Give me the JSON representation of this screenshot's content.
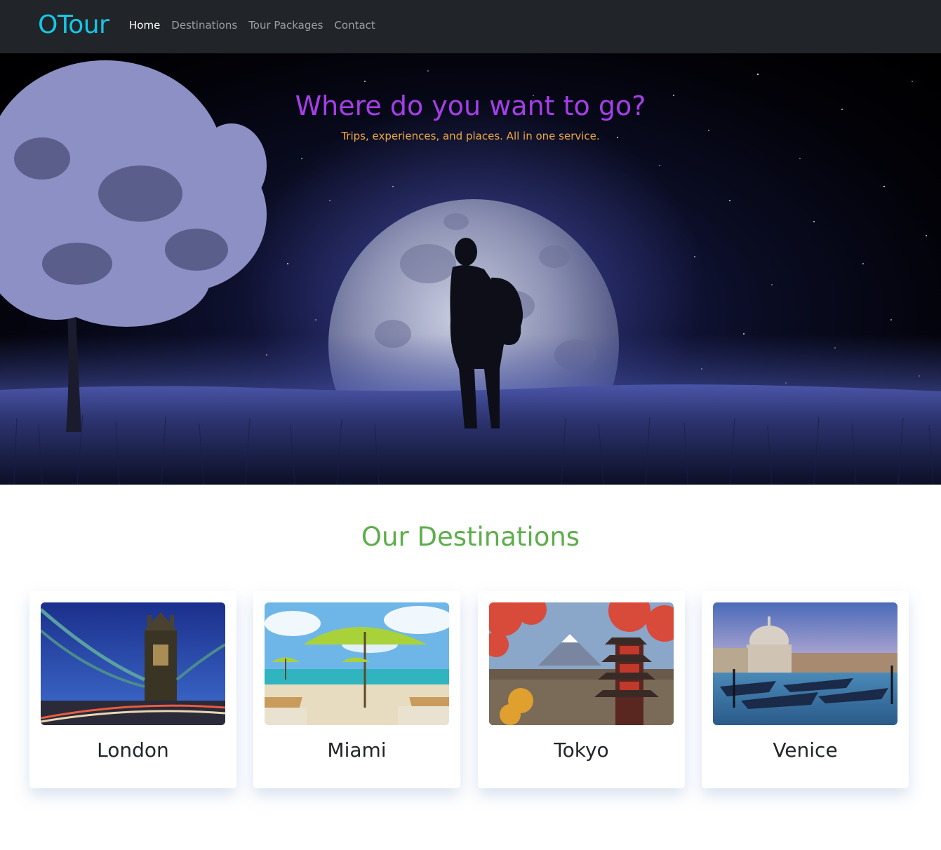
{
  "navbar": {
    "brand": "OTour",
    "links": [
      {
        "label": "Home",
        "active": true
      },
      {
        "label": "Destinations",
        "active": false
      },
      {
        "label": "Tour Packages",
        "active": false
      },
      {
        "label": "Contact",
        "active": false
      }
    ]
  },
  "hero": {
    "title": "Where do you want to go?",
    "subtitle": "Trips, experiences, and places. All in one service."
  },
  "destinations": {
    "heading": "Our Destinations",
    "cards": [
      {
        "name": "London"
      },
      {
        "name": "Miami"
      },
      {
        "name": "Tokyo"
      },
      {
        "name": "Venice"
      }
    ]
  },
  "colors": {
    "navbar_bg": "#212529",
    "brand": "#16c6e6",
    "hero_title": "#a63ee8",
    "hero_subtitle": "#f0a93c",
    "section_heading": "#5cae4a"
  }
}
